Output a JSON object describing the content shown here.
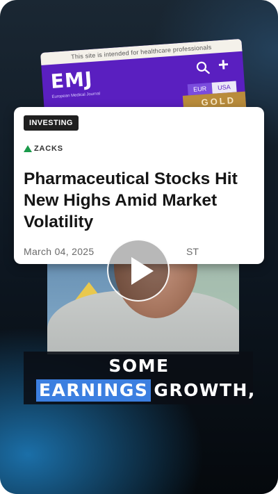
{
  "emj": {
    "banner": "This site is intended for healthcare professionals",
    "logo": "EMJ",
    "subtitle": "European Medical Journal",
    "currency_eur": "EUR",
    "currency_usa": "USA",
    "gold_label": "GOLD"
  },
  "article": {
    "tag": "INVESTING",
    "source": "ZACKS",
    "headline": "Pharmaceutical Stocks Hit New Highs Amid Market Volatility",
    "date": "March 04, 2025",
    "date_tail": "ST"
  },
  "caption": {
    "line1": "SOME",
    "highlight": "EARNINGS",
    "rest": "GROWTH,"
  },
  "colors": {
    "emj_purple": "#5a1fc0",
    "caption_highlight": "#3c7fe0",
    "zacks_green": "#1a9a4a"
  },
  "icons": [
    "search-icon",
    "plus-icon",
    "play-icon",
    "zacks-logo-icon"
  ]
}
